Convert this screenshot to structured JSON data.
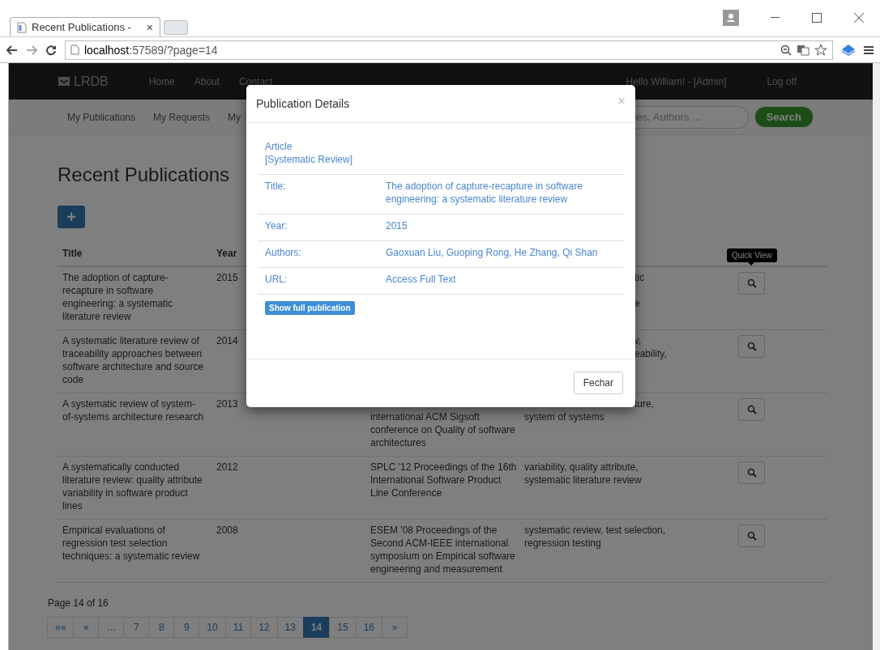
{
  "browser": {
    "tab_title": "Recent Publications - ",
    "tab_close": "×",
    "url_host": "localhost",
    "url_rest": ":57589/?page=14"
  },
  "navbar": {
    "brand": "LRDB",
    "links": [
      "Home",
      "About",
      "Contact"
    ],
    "greeting": "Hello William! - [Admin]",
    "logoff": "Log off"
  },
  "subnav": {
    "links": [
      "My Publications",
      "My Requests",
      "My"
    ],
    "search_placeholder": "ies, Authors ...",
    "search_button": "Search"
  },
  "heading": "Recent Publications",
  "add_button": "+",
  "table": {
    "columns": [
      "Title",
      "Year"
    ],
    "rows": [
      {
        "title": "The adoption of capture-recapture in software engineering: a systematic literature review",
        "year": "2015",
        "keywords": [
          {
            "text": "tic",
            "cut": true,
            "hidden_above": false
          },
          {
            "text": "e",
            "cut": true,
            "hidden_above": true
          }
        ],
        "tooltip": "Quick View"
      },
      {
        "title": "A systematic literature review of traceability approaches between software architecture and source code",
        "year": "2014",
        "keywords": [
          {
            "text": "v,",
            "cut": true,
            "hidden_above": false
          },
          {
            "text": "eability,",
            "cut": true,
            "hidden_above": false
          }
        ]
      },
      {
        "title": "A systematic review of system-of-systems architecture research",
        "year": "2013",
        "venue": [
          {
            "text": "international ACM Sigsoft",
            "cut": false,
            "hidden_above": true
          },
          {
            "text": "conference on Quality of software",
            "cut": false,
            "hidden_above": false
          },
          {
            "text": "architectures",
            "cut": false,
            "hidden_above": false
          }
        ],
        "keywords": [
          {
            "text": "ture,",
            "cut": true,
            "hidden_above": false
          },
          {
            "text": "system of systems",
            "cut": false,
            "hidden_above": false
          }
        ]
      },
      {
        "title": "A systematically conducted literature review: quality attribute variability in software product lines",
        "year": "2012",
        "venue": "SPLC '12 Proceedings of the 16th International Software Product Line Conference",
        "keywords": "variability, quality attribute, systematic literature review"
      },
      {
        "title": "Empirical evaluations of regression test selection techniques: a systematic review",
        "year": "2008",
        "venue": "ESEM '08 Proceedings of the Second ACM-IEEE international symposium on Empirical software engineering and measurement",
        "keywords": "systematic review, test selection, regression testing"
      }
    ]
  },
  "page_info": "Page 14 of 16",
  "pagination": [
    {
      "label": "««",
      "selected": false
    },
    {
      "label": "«",
      "selected": false
    },
    {
      "label": "…",
      "selected": false
    },
    {
      "label": "7",
      "selected": false
    },
    {
      "label": "8",
      "selected": false
    },
    {
      "label": "9",
      "selected": false
    },
    {
      "label": "10",
      "selected": false
    },
    {
      "label": "11",
      "selected": false
    },
    {
      "label": "12",
      "selected": false
    },
    {
      "label": "13",
      "selected": false
    },
    {
      "label": "14",
      "selected": true
    },
    {
      "label": "15",
      "selected": false
    },
    {
      "label": "16",
      "selected": false
    },
    {
      "label": "»",
      "selected": false
    }
  ],
  "modal": {
    "title": "Publication Details",
    "close": "×",
    "type": "Article",
    "category": "[Systematic Review]",
    "fields": [
      {
        "label": "Title:",
        "value": "The adoption of capture-recapture in software engineering: a systematic literature review"
      },
      {
        "label": "Year:",
        "value": "2015"
      },
      {
        "label": "Authors:",
        "value": "Gaoxuan Liu, Guoping Rong, He Zhang, Qi Shan"
      },
      {
        "label": "URL:",
        "value": "Access Full Text"
      }
    ],
    "show_button": "Show full publication",
    "footer_button": "Fechar"
  }
}
